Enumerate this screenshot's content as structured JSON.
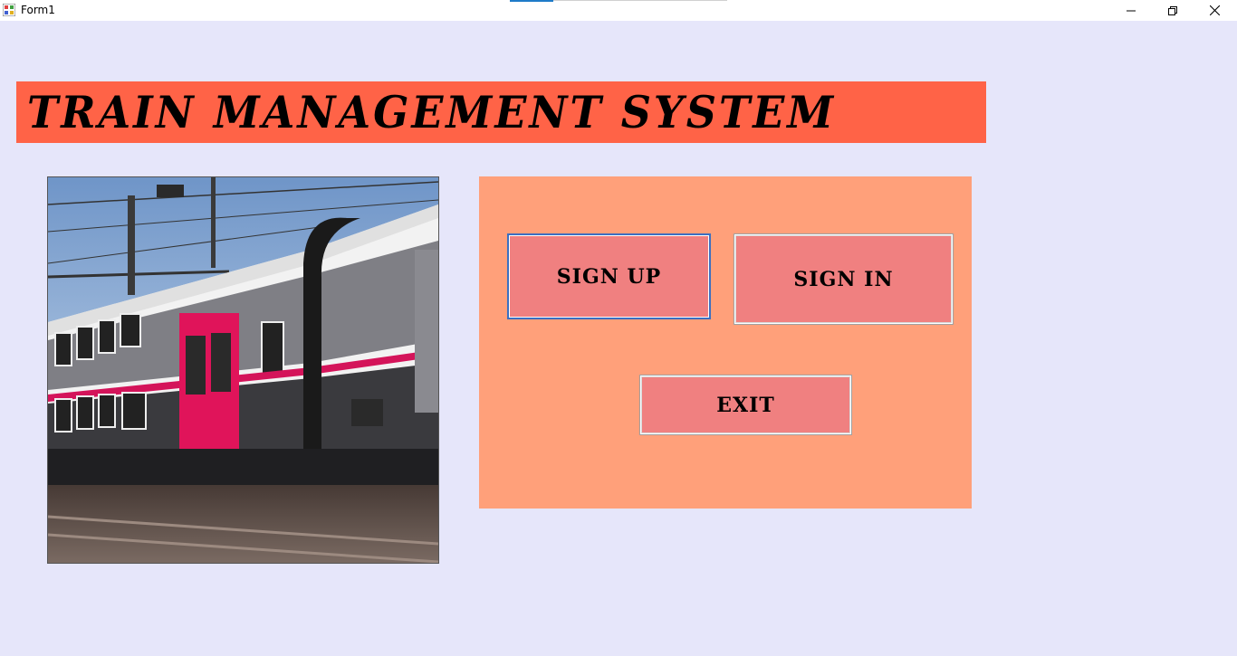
{
  "window": {
    "title": "Form1",
    "icons": {
      "app": "winforms-app-icon",
      "minimize": "minimize-icon",
      "maximize": "restore-icon",
      "close": "close-icon"
    }
  },
  "banner": {
    "title": "TRAIN MANAGEMENT SYSTEM",
    "bg_color": "#FF6347"
  },
  "picture": {
    "description": "train-photo"
  },
  "panel": {
    "bg_color": "#FFA07A",
    "button_color": "#F08080",
    "buttons": {
      "sign_up": "SIGN UP",
      "sign_in": "SIGN IN",
      "exit": "EXIT"
    }
  },
  "form_bg_color": "#E6E6FA"
}
